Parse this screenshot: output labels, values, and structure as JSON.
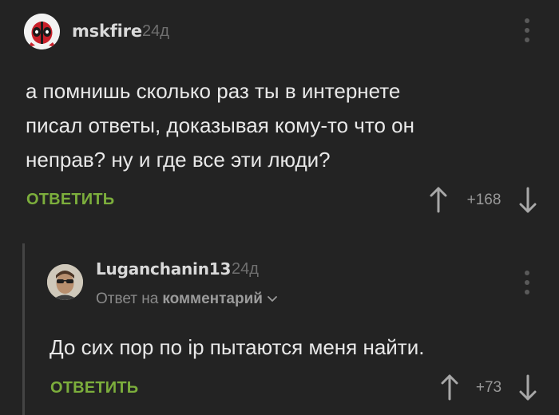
{
  "comment": {
    "username": "mskfire",
    "time": "24д",
    "text": "а помнишь сколько раз ты в интернете\nписал ответы, доказывая кому-то что он\nнеправ? ну и где все эти люди?",
    "reply_label": "ОТВЕТИТЬ",
    "rating": "+168"
  },
  "reply": {
    "username": "Luganchanin13",
    "time": "24д",
    "reply_to_prefix": "Ответ на",
    "reply_to_link": "комментарий",
    "text": "До сих пор по ip пытаются меня найти.",
    "reply_label": "ОТВЕТИТЬ",
    "rating": "+73"
  },
  "colors": {
    "background": "#232323",
    "accent_green": "#7cae3c",
    "text_main": "#e8e8e8",
    "text_muted": "#6f6f6f"
  },
  "icons": {
    "more": "vertical-dots-icon",
    "upvote": "arrow-up-icon",
    "downvote": "arrow-down-icon",
    "dropdown": "chevron-down-icon"
  }
}
